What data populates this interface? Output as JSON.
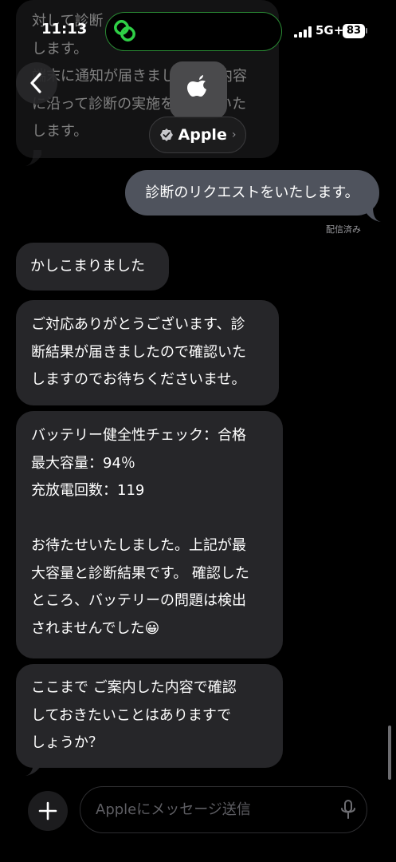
{
  "status": {
    "time": "11:13",
    "network": "5G+",
    "battery": "83"
  },
  "header": {
    "contact_name": "Apple"
  },
  "messages": {
    "faded_top": "対して診断\nします。\n端末に通知が届きましたら、内容\nに沿って診断の実施をお願いいた\nします。",
    "sent_1": "診断のリクエストをいたします。",
    "delivered_label": "配信済み",
    "recv_1": "かしこまりました",
    "recv_2": "ご対応ありがとうございます、診\n断結果が届きましたので確認いた\nしますのでお待ちくださいませ。",
    "recv_3": "バッテリー健全性チェック：合格\n最大容量：94％\n充放電回数：119\n\nお待たせいたしました。上記が最\n大容量と診断結果です。 確認した\nところ、バッテリーの問題は検出\nされませんでした😀",
    "recv_4": "ここまで ご案内した内容で確認\nしておきたいことはありますで\nしょうか？"
  },
  "composer": {
    "placeholder": "Appleにメッセージ送信"
  },
  "icons": {
    "back": "chevron-left-icon",
    "brand": "apple-logo-icon",
    "verified": "verified-badge-icon",
    "add": "plus-icon",
    "mic": "microphone-icon",
    "island": "linked-rings-icon"
  },
  "colors": {
    "sent_bubble": "#4f535d",
    "received_bubble": "#262629",
    "island_accent": "#2fcf46"
  }
}
